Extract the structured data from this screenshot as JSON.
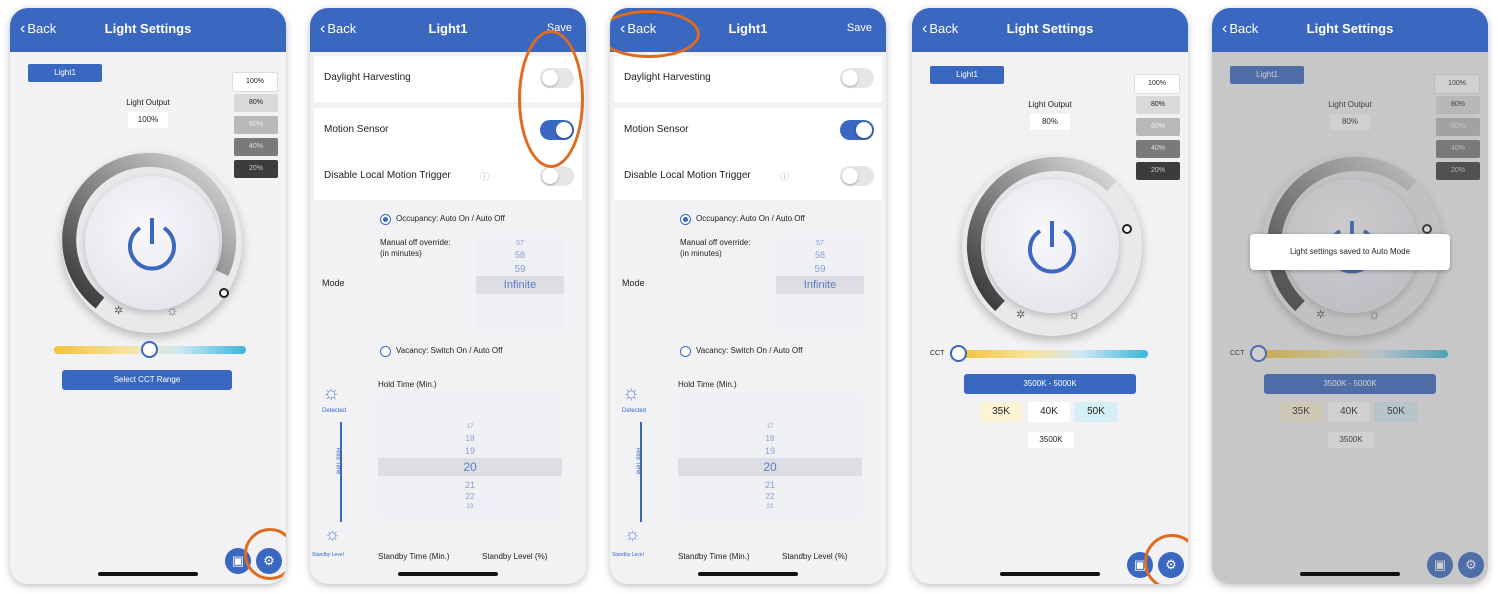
{
  "screen1": {
    "back": "Back",
    "title": "Light Settings",
    "light_tag": "Light1",
    "output_label": "Light Output",
    "output_value": "100%",
    "levels": [
      "100%",
      "80%",
      "60%",
      "40%",
      "20%"
    ],
    "cct_button": "Select CCT Range"
  },
  "screen2": {
    "back": "Back",
    "title": "Light1",
    "save": "Save",
    "daylight": "Daylight Harvesting",
    "motion": "Motion Sensor",
    "disable_local": "Disable Local Motion Trigger",
    "occupancy": "Occupancy: Auto On / Auto Off",
    "manual_override": "Manual off override:",
    "in_minutes": "(in minutes)",
    "mode": "Mode",
    "picker_items": [
      "57",
      "58",
      "59",
      "Infinite"
    ],
    "vacancy": "Vacancy: Switch On / Auto Off",
    "hold_time": "Hold Time (Min.)",
    "detected": "Detected",
    "hold_vertical": "Hold Time",
    "hold_items": [
      "17",
      "18",
      "19",
      "20",
      "21",
      "22",
      "23"
    ],
    "standby_level_label": "Standby Level",
    "standby_time": "Standby Time (Min.)",
    "standby_level": "Standby Level (%)"
  },
  "screen4": {
    "back": "Back",
    "title": "Light Settings",
    "light_tag": "Light1",
    "output_label": "Light Output",
    "output_value": "80%",
    "levels": [
      "100%",
      "80%",
      "60%",
      "40%",
      "20%"
    ],
    "cct_label": "CCT",
    "cct_range": "3500K - 5000K",
    "chips": [
      "35K",
      "40K",
      "50K"
    ],
    "cct_value": "3500K"
  },
  "screen5": {
    "toast": "Light settings saved to Auto Mode"
  },
  "colors": {
    "brand": "#3a67c0",
    "annotation": "#e06a1d"
  }
}
